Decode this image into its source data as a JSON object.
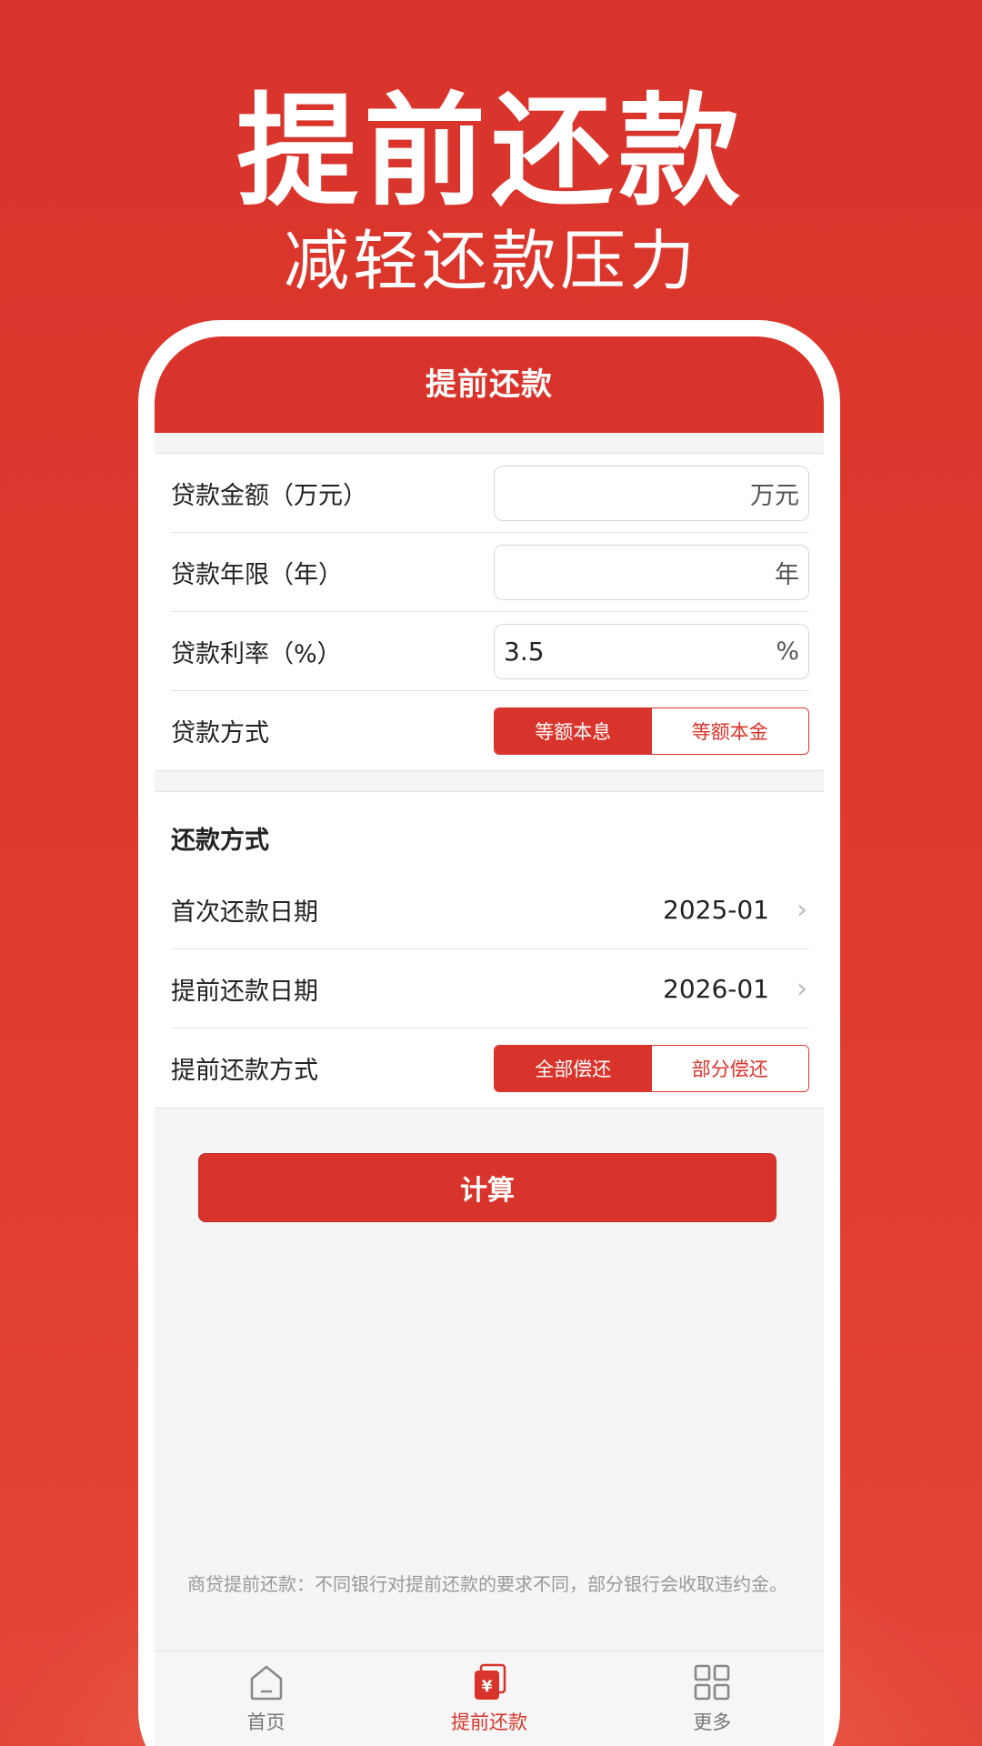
{
  "hero": {
    "title": "提前还款",
    "subtitle": "减轻还款压力"
  },
  "appbar": {
    "title": "提前还款"
  },
  "loan": {
    "amount": {
      "label": "贷款金额（万元）",
      "value": "",
      "unit": "万元"
    },
    "years": {
      "label": "贷款年限（年）",
      "value": "",
      "unit": "年"
    },
    "rate": {
      "label": "贷款利率（%）",
      "value": "3.5",
      "unit": "%"
    },
    "method": {
      "label": "贷款方式",
      "options": [
        "等额本息",
        "等额本金"
      ],
      "selected": "等额本息"
    }
  },
  "repay": {
    "header": "还款方式",
    "first_date": {
      "label": "首次还款日期",
      "value": "2025-01"
    },
    "prepay_date": {
      "label": "提前还款日期",
      "value": "2026-01"
    },
    "prepay_method": {
      "label": "提前还款方式",
      "options": [
        "全部偿还",
        "部分偿还"
      ],
      "selected": "全部偿还"
    }
  },
  "calculate_label": "计算",
  "notice": "商贷提前还款：不同银行对提前还款的要求不同，部分银行会收取违约金。",
  "tabs": [
    {
      "label": "首页",
      "icon": "home-icon"
    },
    {
      "label": "提前还款",
      "icon": "prepay-icon",
      "active": true
    },
    {
      "label": "更多",
      "icon": "grid-icon"
    }
  ],
  "colors": {
    "accent": "#d9342b",
    "background": "#f5f5f5"
  }
}
